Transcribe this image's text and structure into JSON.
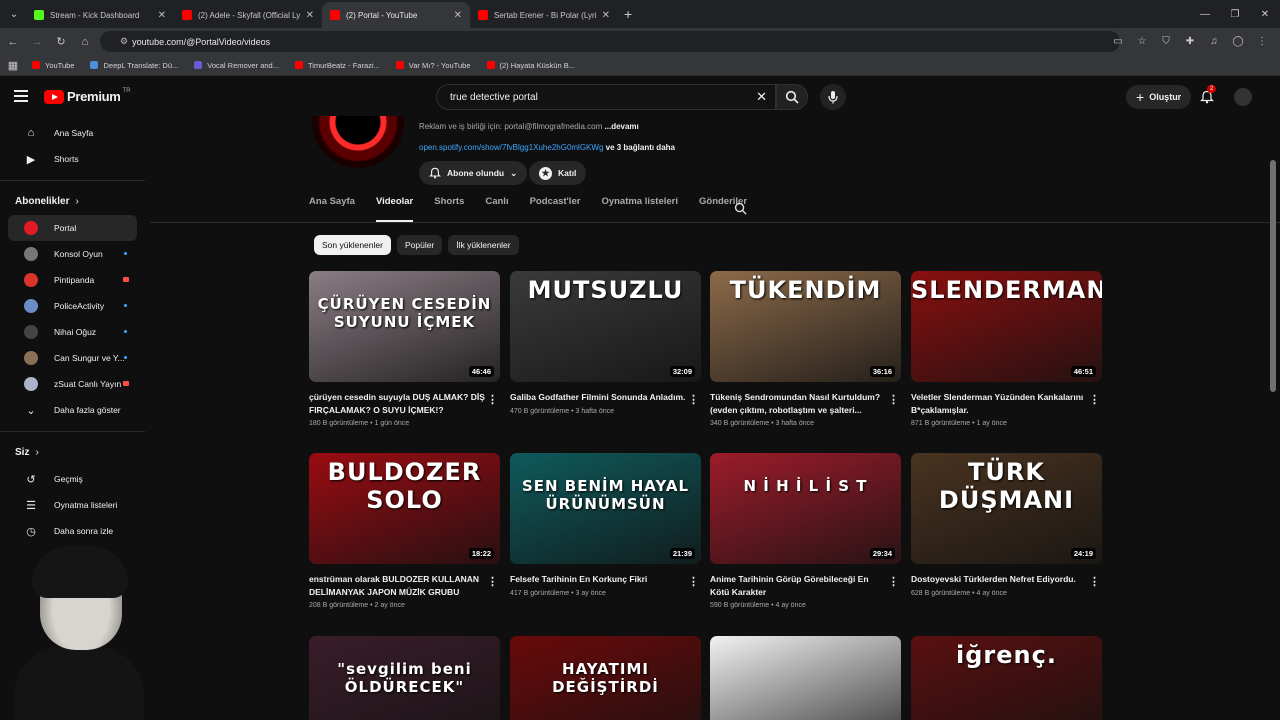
{
  "browser": {
    "tabs": [
      {
        "title": "Stream - Kick Dashboard",
        "color": "#53fc18",
        "active": false
      },
      {
        "title": "(2) Adele - Skyfall (Official Lyric",
        "color": "#ff0000",
        "active": false
      },
      {
        "title": "(2) Portal - YouTube",
        "color": "#ff0000",
        "active": true
      },
      {
        "title": "Sertab Erener - Bi Polar (Lyric V",
        "color": "#ff0000",
        "active": false
      }
    ],
    "url": "youtube.com/@PortalVideo/videos",
    "bookmarks": [
      {
        "label": "YouTube",
        "color": "#ff0000"
      },
      {
        "label": "DeepL Translate: Dü...",
        "color": "#0f2b46"
      },
      {
        "label": "Vocal Remover and...",
        "color": "#6b5bd6"
      },
      {
        "label": "TimurBeatz - Farazi...",
        "color": "#ff0000"
      },
      {
        "label": "Var Mı? - YouTube",
        "color": "#ff0000"
      },
      {
        "label": "(2) Hayata Küskün B...",
        "color": "#ff0000"
      }
    ]
  },
  "header": {
    "logo_text": "Premium",
    "logo_sup": "TR",
    "search_value": "true detective portal",
    "create_label": "Oluştur",
    "notif_count": "2"
  },
  "sidebar": {
    "top": [
      {
        "label": "Ana Sayfa",
        "icon": "home-icon"
      },
      {
        "label": "Shorts",
        "icon": "shorts-icon"
      }
    ],
    "subs_title": "Abonelikler",
    "subs": [
      {
        "label": "Portal",
        "color": "#e01b24",
        "active": true,
        "status": "none"
      },
      {
        "label": "Konsol Oyun",
        "color": "#777777",
        "active": false,
        "status": "dot"
      },
      {
        "label": "Pintipanda",
        "color": "#d9332b",
        "active": false,
        "status": "live"
      },
      {
        "label": "PoliceActivity",
        "color": "#6b8cc7",
        "active": false,
        "status": "dot"
      },
      {
        "label": "Nihai Oğuz",
        "color": "#444444",
        "active": false,
        "status": "dot"
      },
      {
        "label": "Can Sungur ve Y...",
        "color": "#8a7055",
        "active": false,
        "status": "dot"
      },
      {
        "label": "zSuat Canlı Yayın",
        "color": "#aab4c8",
        "active": false,
        "status": "live"
      }
    ],
    "show_more": "Daha fazla göster",
    "you_title": "Siz",
    "you": [
      {
        "label": "Geçmiş",
        "icon": "history-icon"
      },
      {
        "label": "Oynatma listeleri",
        "icon": "playlist-icon"
      },
      {
        "label": "Daha sonra izle",
        "icon": "watch-later-icon"
      }
    ]
  },
  "channel": {
    "desc_prefix": "Reklam ve iş birliği için: portal@filmografmedia.com",
    "desc_more": "...devamı",
    "link": "open.spotify.com/show/7fvBlgg1Xuhe2hG0mlGKWg",
    "link_more": "ve 3 bağlantı daha",
    "subscribed_label": "Abone olundu",
    "join_label": "Katıl",
    "tabs": [
      "Ana Sayfa",
      "Videolar",
      "Shorts",
      "Canlı",
      "Podcast'ler",
      "Oynatma listeleri",
      "Gönderiler"
    ],
    "active_tab": "Videolar",
    "chips": [
      "Son yüklenenler",
      "Popüler",
      "İlk yüklenenler"
    ]
  },
  "videos": [
    {
      "thumb_text": "ÇÜRÜYEN CESEDİN SUYUNU İÇMEK",
      "duration": "46:46",
      "title": "çürüyen cesedin suyuyla DUŞ ALMAK? DİŞ FIRÇALAMAK? O SUYU İÇMEK!?",
      "views": "180 B görüntüleme",
      "age": "1 gün önce",
      "bg": "#8a7d84"
    },
    {
      "thumb_text": "MUTSUZLU",
      "duration": "32:09",
      "title": "Galiba Godfather Filmini Sonunda Anladım.",
      "views": "470 B görüntüleme",
      "age": "3 hafta önce",
      "bg": "#3a3a3a"
    },
    {
      "thumb_text": "TÜKENDİM",
      "duration": "36:16",
      "title": "Tükeniş Sendromundan Nasıl Kurtuldum? (evden çıktım, robotlaştım ve şalteri...",
      "views": "340 B görüntüleme",
      "age": "3 hafta önce",
      "bg": "#8c6a4a"
    },
    {
      "thumb_text": "SLENDERMAN",
      "duration": "46:51",
      "title": "Veletler Slenderman Yüzünden Kankalarını B*çaklamışlar.",
      "views": "871 B görüntüleme",
      "age": "1 ay önce",
      "bg": "#8a1010"
    },
    {
      "thumb_text": "BULDOZER SOLO",
      "duration": "18:22",
      "title": "enstrüman olarak BULDOZER KULLANAN DELİMANYAK JAPON MÜZİK GRUBU",
      "views": "208 B görüntüleme",
      "age": "2 ay önce",
      "bg": "#9a0c12"
    },
    {
      "thumb_text": "SEN BENİM HAYAL ÜRÜNÜMSÜN",
      "duration": "21:39",
      "title": "Felsefe Tarihinin En Korkunç Fikri",
      "views": "417 B görüntüleme",
      "age": "3 ay önce",
      "bg": "#0f5a5c"
    },
    {
      "thumb_text": "N İ H İ L İ S T",
      "duration": "29:34",
      "title": "Anime Tarihinin Görüp Görebileceği En Kötü Karakter",
      "views": "590 B görüntüleme",
      "age": "4 ay önce",
      "bg": "#9c1c2a"
    },
    {
      "thumb_text": "TÜRK DÜŞMANI",
      "duration": "24:19",
      "title": "Dostoyevski Türklerden Nefret Ediyordu.",
      "views": "628 B görüntüleme",
      "age": "4 ay önce",
      "bg": "#4a3320"
    },
    {
      "thumb_text": "\"sevgilim beni ÖLDÜRECEK\"",
      "duration": "",
      "title": "",
      "views": "",
      "age": "",
      "bg": "#3a1d2a"
    },
    {
      "thumb_text": "HAYATIMI DEĞİŞTİRDİ",
      "duration": "",
      "title": "",
      "views": "",
      "age": "",
      "bg": "#6a0a0a"
    },
    {
      "thumb_text": "",
      "duration": "",
      "title": "",
      "views": "",
      "age": "",
      "bg": "#f2f2f2"
    },
    {
      "thumb_text": "iğrenç.",
      "duration": "",
      "title": "",
      "views": "",
      "age": "",
      "bg": "#5a1010"
    }
  ]
}
